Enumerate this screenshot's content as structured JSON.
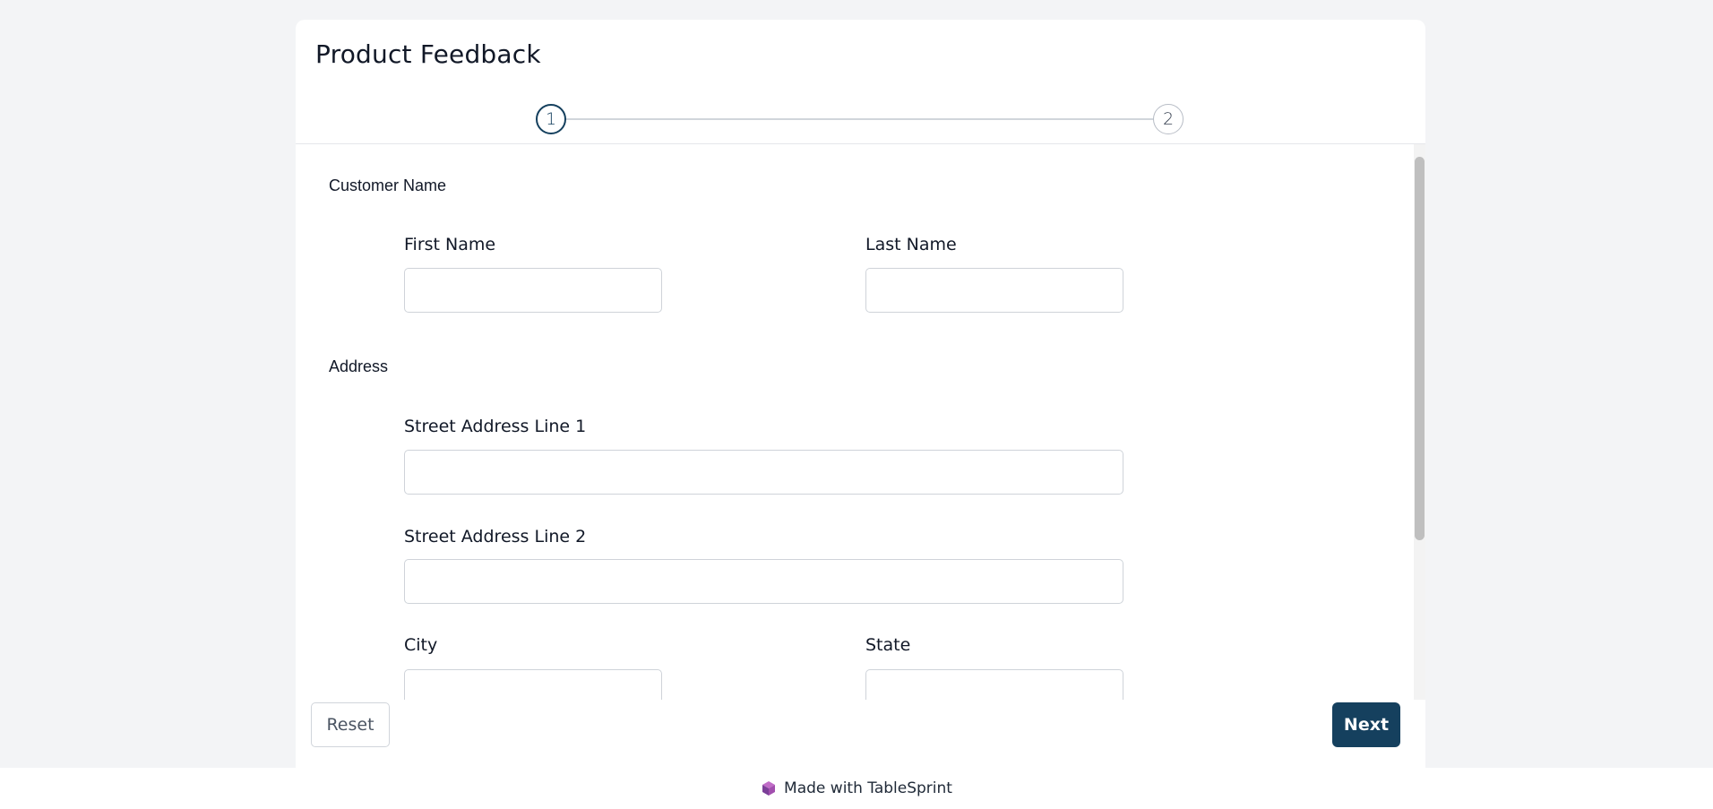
{
  "form": {
    "title": "Product Feedback",
    "steps": [
      {
        "number": "1",
        "state": "active"
      },
      {
        "number": "2",
        "state": "inactive"
      }
    ]
  },
  "sections": {
    "customer_name": {
      "label": "Customer Name",
      "first_name": {
        "label": "First Name",
        "value": "",
        "placeholder": ""
      },
      "last_name": {
        "label": "Last Name",
        "value": "",
        "placeholder": ""
      }
    },
    "address": {
      "label": "Address",
      "street_line_1": {
        "label": "Street Address Line 1",
        "value": "",
        "placeholder": ""
      },
      "street_line_2": {
        "label": "Street Address Line 2",
        "value": "",
        "placeholder": ""
      },
      "city": {
        "label": "City",
        "value": "",
        "placeholder": ""
      },
      "state": {
        "label": "State",
        "value": "",
        "placeholder": ""
      }
    }
  },
  "actions": {
    "reset_label": "Reset",
    "next_label": "Next"
  },
  "footer": {
    "text": "Made with TableSprint",
    "icon": "tablesprint-cube-icon"
  },
  "colors": {
    "page_background": "#f3f4f6",
    "primary": "#15405e",
    "input_border": "#cfd3d9"
  }
}
